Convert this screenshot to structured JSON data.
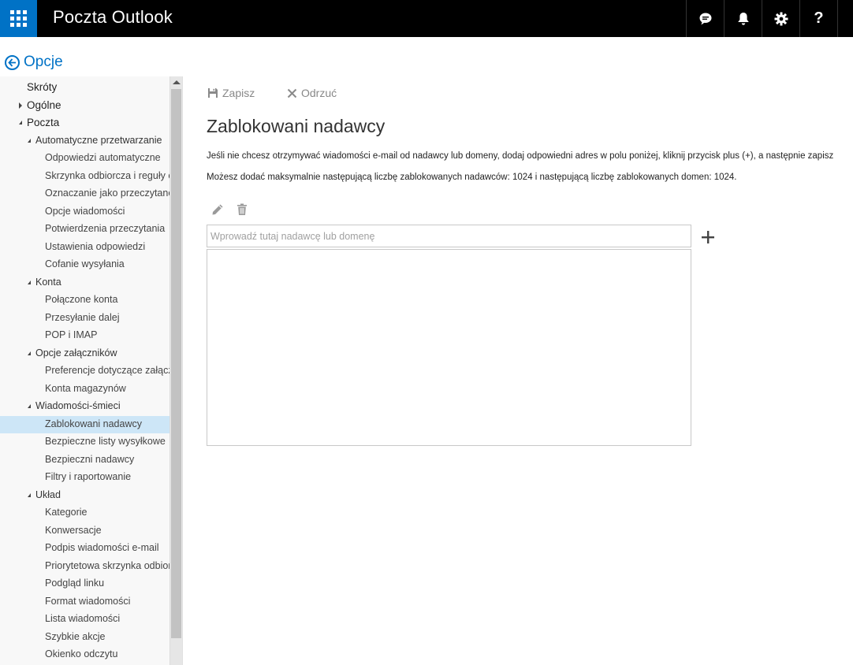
{
  "header": {
    "app_title": "Poczta Outlook",
    "icons": [
      "app-launcher-icon",
      "chat-icon",
      "bell-icon",
      "gear-icon",
      "help-icon"
    ]
  },
  "back": {
    "label": "Opcje"
  },
  "sidebar": {
    "items": [
      {
        "label": "Skróty",
        "level": 0,
        "expander": "none"
      },
      {
        "label": "Ogólne",
        "level": 0,
        "expander": "collapsed"
      },
      {
        "label": "Poczta",
        "level": 0,
        "expander": "expanded"
      },
      {
        "label": "Automatyczne przetwarzanie",
        "level": 1,
        "expander": "expanded"
      },
      {
        "label": "Odpowiedzi automatyczne",
        "level": 2
      },
      {
        "label": "Skrzynka odbiorcza i reguły oc",
        "level": 2
      },
      {
        "label": "Oznaczanie jako przeczytane",
        "level": 2
      },
      {
        "label": "Opcje wiadomości",
        "level": 2
      },
      {
        "label": "Potwierdzenia przeczytania",
        "level": 2
      },
      {
        "label": "Ustawienia odpowiedzi",
        "level": 2
      },
      {
        "label": "Cofanie wysyłania",
        "level": 2
      },
      {
        "label": "Konta",
        "level": 1,
        "expander": "expanded"
      },
      {
        "label": "Połączone konta",
        "level": 2
      },
      {
        "label": "Przesyłanie dalej",
        "level": 2
      },
      {
        "label": "POP i IMAP",
        "level": 2
      },
      {
        "label": "Opcje załączników",
        "level": 1,
        "expander": "expanded"
      },
      {
        "label": "Preferencje dotyczące załączn",
        "level": 2
      },
      {
        "label": "Konta magazynów",
        "level": 2
      },
      {
        "label": "Wiadomości-śmieci",
        "level": 1,
        "expander": "expanded"
      },
      {
        "label": "Zablokowani nadawcy",
        "level": 2,
        "selected": true
      },
      {
        "label": "Bezpieczne listy wysyłkowe",
        "level": 2
      },
      {
        "label": "Bezpieczni nadawcy",
        "level": 2
      },
      {
        "label": "Filtry i raportowanie",
        "level": 2
      },
      {
        "label": "Układ",
        "level": 1,
        "expander": "expanded"
      },
      {
        "label": "Kategorie",
        "level": 2
      },
      {
        "label": "Konwersacje",
        "level": 2
      },
      {
        "label": "Podpis wiadomości e-mail",
        "level": 2
      },
      {
        "label": "Priorytetowa skrzynka odbiorc",
        "level": 2
      },
      {
        "label": "Podgląd linku",
        "level": 2
      },
      {
        "label": "Format wiadomości",
        "level": 2
      },
      {
        "label": "Lista wiadomości",
        "level": 2
      },
      {
        "label": "Szybkie akcje",
        "level": 2
      },
      {
        "label": "Okienko odczytu",
        "level": 2
      }
    ]
  },
  "toolbar": {
    "save_label": "Zapisz",
    "discard_label": "Odrzuć"
  },
  "main": {
    "title": "Zablokowani nadawcy",
    "description": "Jeśli nie chcesz otrzymywać wiadomości e-mail od nadawcy lub domeny, dodaj odpowiedni adres w polu poniżej, kliknij przycisk plus (+), a następnie zapisz",
    "limits": "Możesz dodać maksymalnie następującą liczbę zablokowanych nadawców: 1024 i następującą liczbę zablokowanych domen: 1024.",
    "input_placeholder": "Wprowadź tutaj nadawcę lub domenę",
    "input_value": ""
  },
  "colors": {
    "accent": "#0072c6",
    "topbar": "#000000",
    "selected": "#cde6f7",
    "sidebar": "#f8f8f8"
  }
}
